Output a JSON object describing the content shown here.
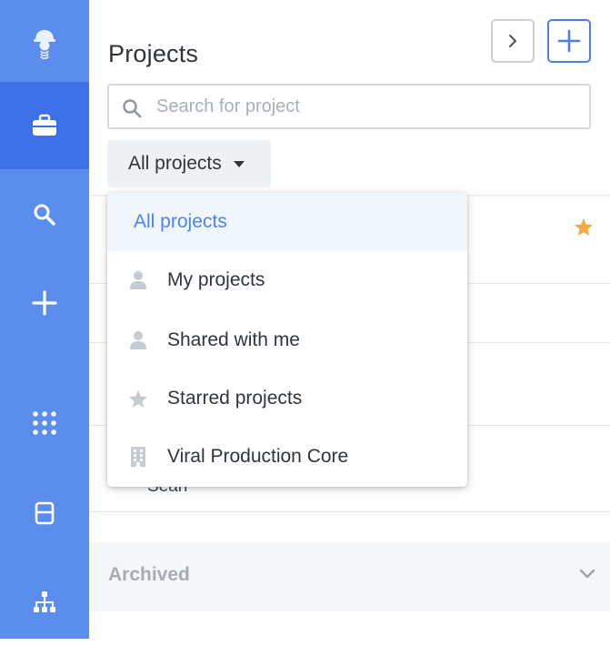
{
  "header": {
    "title": "Projects"
  },
  "search": {
    "placeholder": "Search for project",
    "value": ""
  },
  "filter": {
    "selected_label": "All projects"
  },
  "dropdown": {
    "items": [
      {
        "label": "All projects",
        "icon": "none",
        "selected": true
      },
      {
        "label": "My projects",
        "icon": "person-icon",
        "selected": false
      },
      {
        "label": "Shared with me",
        "icon": "person-icon",
        "selected": false
      },
      {
        "label": "Starred projects",
        "icon": "star-icon",
        "selected": false
      },
      {
        "label": "Viral Production Core",
        "icon": "building-icon",
        "selected": false
      }
    ]
  },
  "list": {
    "partial_text": "Sean"
  },
  "archived": {
    "label": "Archived"
  },
  "sidebar": {
    "items": [
      {
        "icon": "lab-avatar-icon",
        "active": false
      },
      {
        "icon": "briefcase-icon",
        "active": true
      },
      {
        "icon": "search-icon",
        "active": false
      },
      {
        "icon": "plus-icon",
        "active": false
      },
      {
        "icon": "apps-grid-icon",
        "active": false
      },
      {
        "icon": "layout-icon",
        "active": false
      },
      {
        "icon": "hierarchy-icon",
        "active": false
      }
    ]
  },
  "colors": {
    "rail": "#5b8def",
    "rail_active": "#3d6fe9",
    "accent": "#4a86e8",
    "star": "#f2a94a"
  }
}
